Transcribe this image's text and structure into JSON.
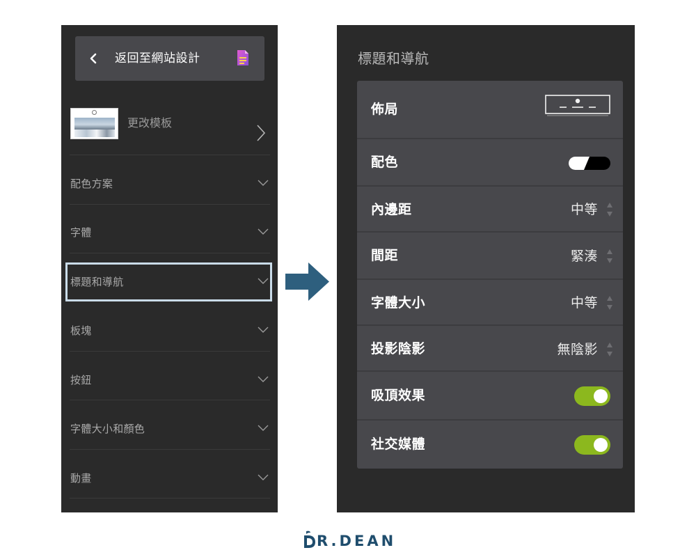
{
  "left_panel": {
    "back_label": "返回至網站設計",
    "template_label": "更改模板",
    "items": [
      {
        "label": "配色方案"
      },
      {
        "label": "字體"
      },
      {
        "label": "標題和導航"
      },
      {
        "label": "板塊"
      },
      {
        "label": "按鈕"
      },
      {
        "label": "字體大小和顏色"
      },
      {
        "label": "動畫"
      }
    ],
    "highlighted_item": "標題和導航"
  },
  "right_panel": {
    "title": "標題和導航",
    "rows": {
      "layout": {
        "label": "佈局"
      },
      "color": {
        "label": "配色"
      },
      "padding": {
        "label": "內邊距",
        "value": "中等"
      },
      "spacing": {
        "label": "間距",
        "value": "緊湊"
      },
      "font_size": {
        "label": "字體大小",
        "value": "中等"
      },
      "shadow": {
        "label": "投影陰影",
        "value": "無陰影"
      },
      "sticky": {
        "label": "吸頂效果",
        "enabled": true
      },
      "social": {
        "label": "社交媒體",
        "enabled": true
      }
    }
  },
  "brand": {
    "text": "R.DEAN"
  },
  "colors": {
    "panel_bg": "#2a2a2a",
    "card_bg": "#48484c",
    "toggle_on": "#8cb81e",
    "highlight_border": "#c9dbe8",
    "arrow": "#2e5f7e",
    "doc_icon": "#c05bd6"
  },
  "icons": {
    "back": "chevron-left-icon",
    "document": "document-icon",
    "template": "chevron-right-icon",
    "expand": "chevron-down-icon",
    "spinner": "up-down-spinner-icon"
  }
}
